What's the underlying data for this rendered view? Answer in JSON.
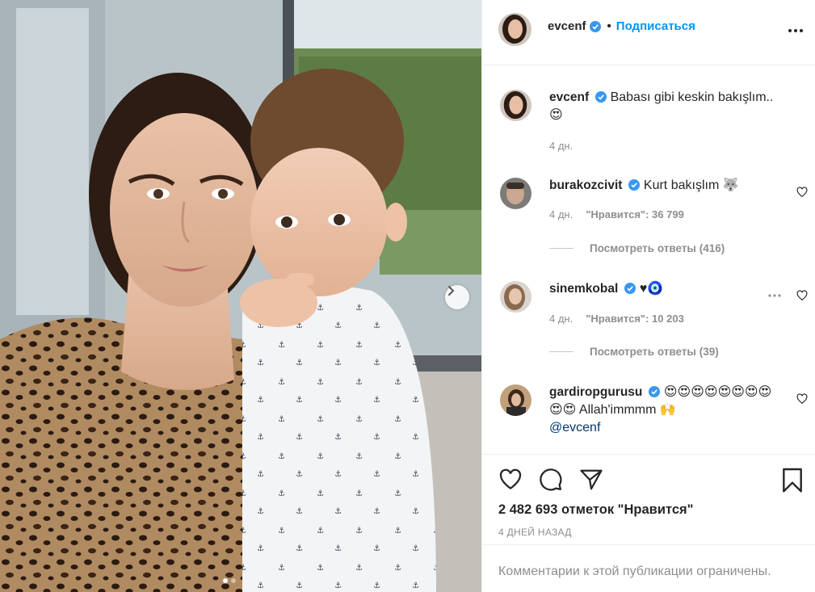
{
  "post": {
    "author": "evcenf",
    "follow_label": "Подписаться",
    "separator": "•",
    "caption_text": "Babası gibi keskin bakışlım..",
    "caption_emoji": "😍",
    "caption_time": "4 дн.",
    "likes_text": "2 482 693 отметок \"Нравится\"",
    "date_text": "4 ДНЕЙ НАЗАД",
    "comments_restricted": "Комментарии к этой публикации ограничены.",
    "carousel": {
      "slide_count": 2,
      "active_index": 0
    }
  },
  "comments": [
    {
      "user": "burakozcivit",
      "text": "Kurt bakışlım 🐺",
      "time": "4 дн.",
      "likes": "\"Нравится\": 36 799",
      "replies": "Посмотреть ответы (416)"
    },
    {
      "user": "sinemkobal",
      "text": "♥🧿",
      "time": "4 дн.",
      "likes": "\"Нравится\": 10 203",
      "replies": "Посмотреть ответы (39)"
    },
    {
      "user": "gardiropgurusu",
      "text": "😍😍😍😍😍😍😍😍😍😍 Allah'immmm 🙌",
      "mention": "@evcenf"
    }
  ],
  "icons": {
    "verified": "verified-badge-icon",
    "more": "more-options-icon",
    "like": "heart-icon",
    "comment": "comment-icon",
    "share": "paper-plane-icon",
    "save": "bookmark-icon",
    "next": "chevron-right-icon"
  },
  "colors": {
    "accent": "#0095f6",
    "text": "#262626",
    "secondary": "#8e8e8e",
    "border": "#efefef"
  }
}
